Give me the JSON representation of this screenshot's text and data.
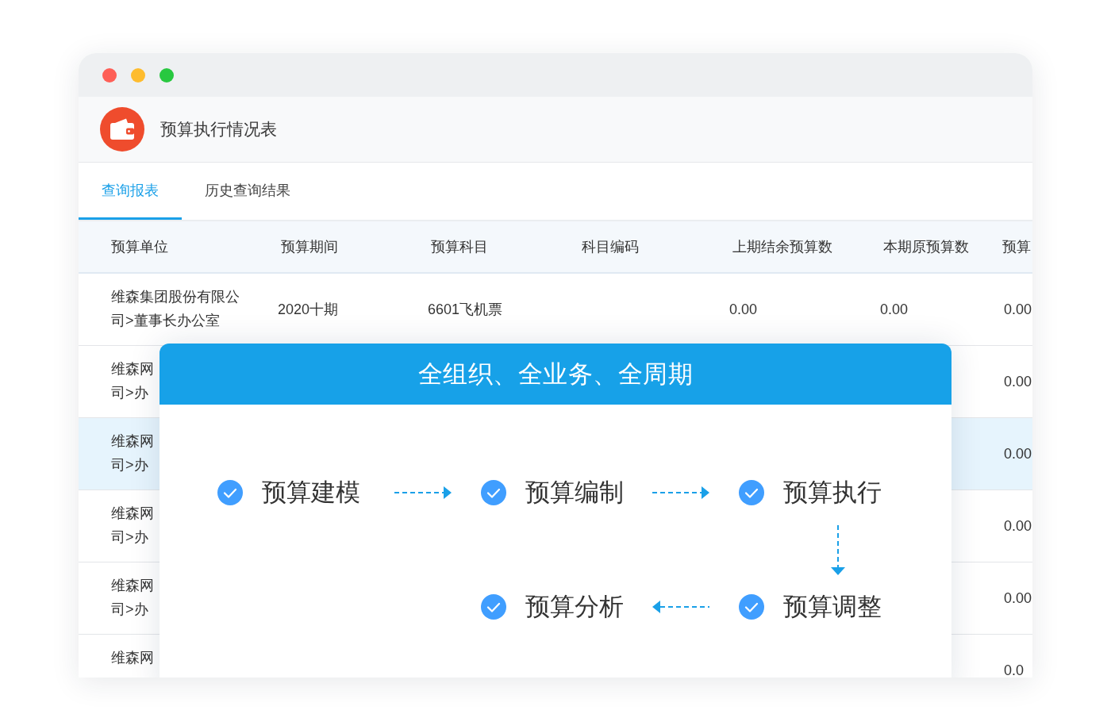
{
  "header": {
    "title": "预算执行情况表"
  },
  "tabs": [
    {
      "label": "查询报表",
      "selected": true
    },
    {
      "label": "历史查询结果",
      "selected": false
    }
  ],
  "table": {
    "columns": [
      "预算单位",
      "预算期间",
      "预算科目",
      "科目编码",
      "上期结余预算数",
      "本期原预算数",
      "预算"
    ],
    "rows": [
      {
        "selected": false,
        "unit": [
          "维森集团股份有限公",
          "司>董事长办公室"
        ],
        "period": "2020十期",
        "subject": "6601飞机票",
        "prev_balance": "0.00",
        "current_budget": "0.00",
        "column_7": "0.00"
      },
      {
        "selected": false,
        "unit": [
          "维森网",
          "司>办"
        ],
        "column_7": "0.00"
      },
      {
        "selected": true,
        "unit": [
          "维森网",
          "司>办"
        ],
        "column_7": "0.00"
      },
      {
        "selected": false,
        "unit": [
          "维森网",
          "司>办"
        ],
        "column_7": "0.00"
      },
      {
        "selected": false,
        "unit": [
          "维森网",
          "司>办"
        ],
        "column_7": "0.00"
      },
      {
        "selected": false,
        "unit": [
          "维森网"
        ],
        "column_7": "0.0"
      }
    ]
  },
  "overlay": {
    "title": "全组织、全业务、全周期",
    "steps": [
      {
        "label": "预算建模",
        "done": true
      },
      {
        "label": "预算编制",
        "done": true
      },
      {
        "label": "预算执行",
        "done": true
      },
      {
        "label": "预算分析",
        "done": true
      },
      {
        "label": "预算调整",
        "done": true
      }
    ]
  }
}
